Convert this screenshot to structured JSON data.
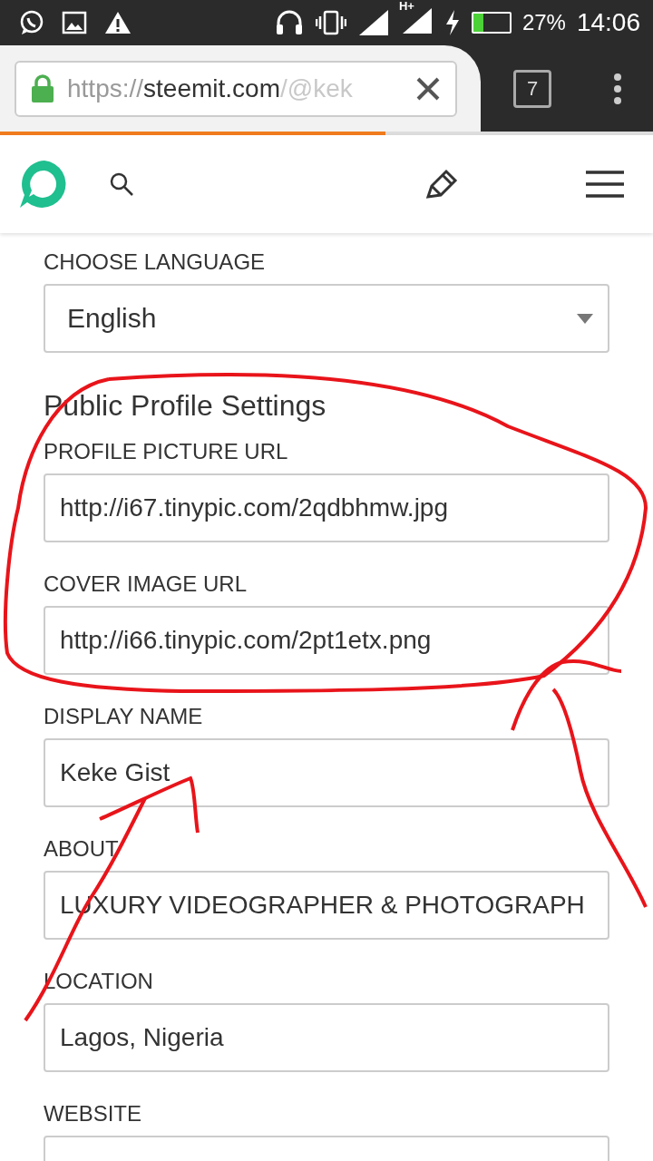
{
  "status_bar": {
    "network": "H+",
    "battery": "27%",
    "time": "14:06"
  },
  "browser": {
    "url_scheme": "https://",
    "url_host": "steemit.com",
    "url_path": "/@kek",
    "tab_count": "7",
    "level": 0.59
  },
  "settings": {
    "language_label": "CHOOSE LANGUAGE",
    "language": "English",
    "section_title": "Public Profile Settings",
    "fields": [
      {
        "label": "PROFILE PICTURE URL",
        "value": "http://i67.tinypic.com/2qdbhmw.jpg"
      },
      {
        "label": "COVER IMAGE URL",
        "value": "http://i66.tinypic.com/2pt1etx.png"
      },
      {
        "label": "DISPLAY NAME",
        "value": "Keke Gist"
      },
      {
        "label": "ABOUT",
        "value": "LUXURY VIDEOGRAPHER & PHOTOGRAPH"
      },
      {
        "label": "LOCATION",
        "value": "Lagos, Nigeria"
      },
      {
        "label": "WEBSITE"
      }
    ]
  }
}
